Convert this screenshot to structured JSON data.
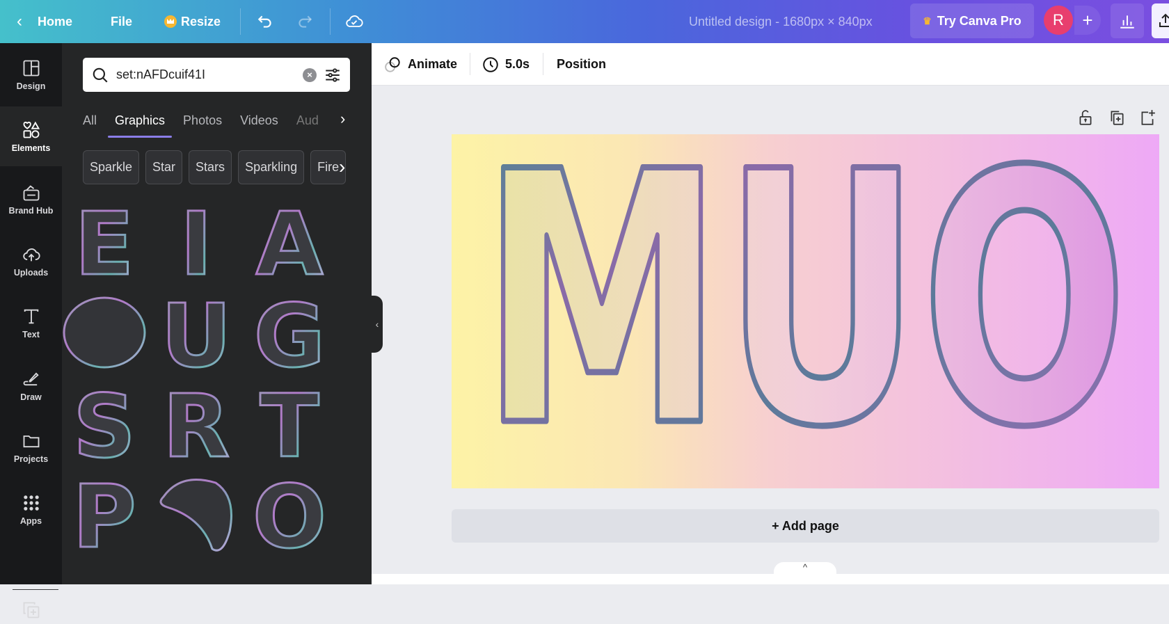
{
  "topbar": {
    "home": "Home",
    "file": "File",
    "resize": "Resize",
    "title": "Untitled design - 1680px × 840px",
    "try_pro": "Try Canva Pro",
    "avatar_initial": "R",
    "gradient": [
      "#45c0cb",
      "#7a4fe0"
    ]
  },
  "rail": {
    "items": [
      {
        "label": "Design",
        "icon": "layout-icon"
      },
      {
        "label": "Elements",
        "icon": "shapes-icon",
        "active": true
      },
      {
        "label": "Brand Hub",
        "icon": "brand-icon"
      },
      {
        "label": "Uploads",
        "icon": "cloud-upload-icon"
      },
      {
        "label": "Text",
        "icon": "text-icon"
      },
      {
        "label": "Draw",
        "icon": "draw-icon"
      },
      {
        "label": "Projects",
        "icon": "folder-icon"
      },
      {
        "label": "Apps",
        "icon": "apps-icon"
      }
    ]
  },
  "panel": {
    "search": {
      "value": "set:nAFDcuif41I"
    },
    "tabs": [
      {
        "label": "All"
      },
      {
        "label": "Graphics",
        "active": true
      },
      {
        "label": "Photos"
      },
      {
        "label": "Videos"
      },
      {
        "label": "Aud"
      }
    ],
    "chips": [
      "Sparkle",
      "Star",
      "Stars",
      "Sparkling",
      "Fire"
    ],
    "graphics": [
      "E",
      "I",
      "A",
      "O",
      "U",
      "G",
      "S",
      "R",
      "T",
      "P",
      "",
      "O"
    ]
  },
  "toolbar": {
    "animate": "Animate",
    "duration": "5.0s",
    "position": "Position"
  },
  "canvas": {
    "letters": "MUO",
    "colors": [
      "#fdf3a6",
      "#f3bfe0",
      "#eea9f6"
    ]
  },
  "add_page": "+ Add page"
}
